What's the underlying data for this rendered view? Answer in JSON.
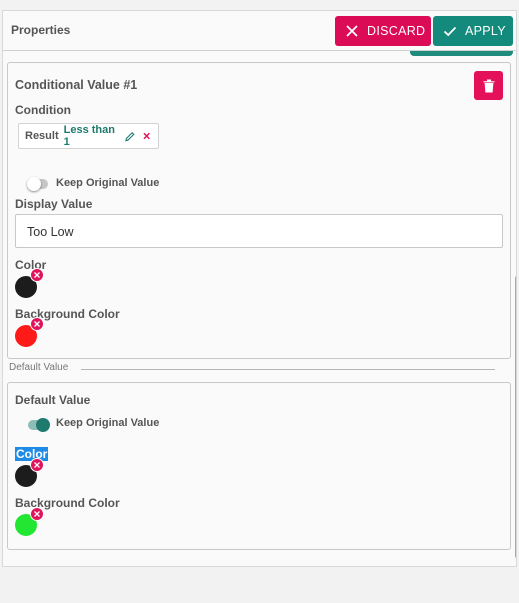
{
  "header": {
    "title": "Properties",
    "discard_label": "DISCARD",
    "apply_label": "APPLY"
  },
  "conditional": {
    "title": "Conditional Value #1",
    "condition_label": "Condition",
    "chip": {
      "key": "Result",
      "value": "Less than 1"
    },
    "keep_original": {
      "label": "Keep Original Value",
      "on": false
    },
    "display_value_label": "Display Value",
    "display_value": "Too Low",
    "color_label": "Color",
    "color": "#1c1c1c",
    "background_color_label": "Background Color",
    "background_color": "#ff1a1a"
  },
  "separator": {
    "label": "Default Value"
  },
  "default": {
    "title": "Default Value",
    "keep_original": {
      "label": "Keep Original Value",
      "on": true
    },
    "color_label": "Color",
    "color": "#1c1c1c",
    "background_color_label": "Background Color",
    "background_color": "#22e632"
  },
  "theme": {
    "discard": "#dc0b55",
    "apply": "#148a7c",
    "delete": "#e5105a",
    "badge": "#e0145c",
    "chip_value": "#1d7b6e"
  }
}
